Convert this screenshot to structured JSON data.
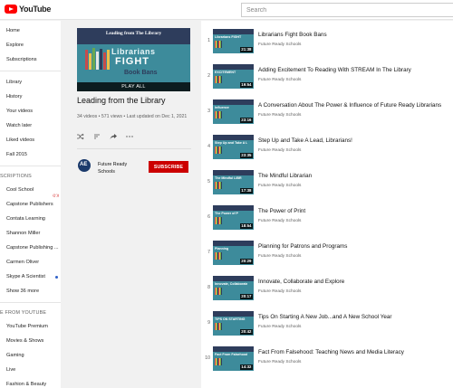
{
  "header": {
    "logo_text": "YouTube",
    "search_placeholder": "Search"
  },
  "sidebar": {
    "main": [
      "Home",
      "Explore",
      "Subscriptions"
    ],
    "library": [
      "Library",
      "History",
      "Your videos",
      "Watch later",
      "Liked videos",
      "Fall 2015"
    ],
    "subscriptions_heading": "SCRIPTIONS",
    "subscriptions": [
      {
        "label": "Cool School",
        "badge": "((·))"
      },
      {
        "label": "Capstone Publishers"
      },
      {
        "label": "Contata Learning"
      },
      {
        "label": "Shannon Miller"
      },
      {
        "label": "Capstone Publishing ..."
      },
      {
        "label": "Carmen Oliver"
      },
      {
        "label": "Skype A Scientist",
        "dot": true
      },
      {
        "label": "Show 36 more"
      }
    ],
    "more_heading": "E FROM YOUTUBE",
    "more": [
      "YouTube Premium",
      "Movies & Shows",
      "Gaming",
      "Live",
      "Fashion & Beauty"
    ]
  },
  "playlist": {
    "hero_subtitle": "Leading from The Library",
    "hero_line1": "Librarians",
    "hero_line2": "FIGHT",
    "hero_line3": "Book Bans",
    "play_all": "PLAY ALL",
    "title": "Leading from the Library",
    "meta": "34 videos • 571 views • Last updated on Dec 1, 2021",
    "owner": "Future Ready Schools",
    "owner_avatar_text": "AE",
    "subscribe_label": "SUBSCRIBE",
    "actions": [
      "shuffle-icon",
      "sort-icon",
      "share-icon",
      "more-icon"
    ]
  },
  "videos": [
    {
      "num": "1",
      "title": "Librarians Fight Book Bans",
      "channel": "Future Ready Schools",
      "duration": "21:38",
      "thumb": "Librarians FIGHT"
    },
    {
      "num": "2",
      "title": "Adding Excitement To Reading With STREAM In The Library",
      "channel": "Future Ready Schools",
      "duration": "19:54",
      "thumb": "EXCITEMENT"
    },
    {
      "num": "3",
      "title": "A Conversation About The Power & Influence of Future Ready Librarians",
      "channel": "Future Ready Schools",
      "duration": "23:16",
      "thumb": "Influence"
    },
    {
      "num": "4",
      "title": "Step Up and Take A Lead, Librarians!",
      "channel": "Future Ready Schools",
      "duration": "23:35",
      "thumb": "Step Up and Take A Lead"
    },
    {
      "num": "5",
      "title": "The Mindful Librarian",
      "channel": "Future Ready Schools",
      "duration": "17:38",
      "thumb": "The Mindful LIBR"
    },
    {
      "num": "6",
      "title": "The Power of Print",
      "channel": "Future Ready Schools",
      "duration": "18:54",
      "thumb": "The Power of P"
    },
    {
      "num": "7",
      "title": "Planning for Patrons and Programs",
      "channel": "Future Ready Schools",
      "duration": "20:29",
      "thumb": "Planning"
    },
    {
      "num": "8",
      "title": "Innovate, Collaborate and Explore",
      "channel": "Future Ready Schools",
      "duration": "20:17",
      "thumb": "Innovate, Collaborate"
    },
    {
      "num": "9",
      "title": "Tips On Starting A New Job...and A New School Year",
      "channel": "Future Ready Schools",
      "duration": "20:42",
      "thumb": "TIPS ON STARTING"
    },
    {
      "num": "10",
      "title": "Fact From Falsehood: Teaching News and Media Literacy",
      "channel": "Future Ready Schools",
      "duration": "14:32",
      "thumb": "Fact From Falsehood"
    }
  ]
}
